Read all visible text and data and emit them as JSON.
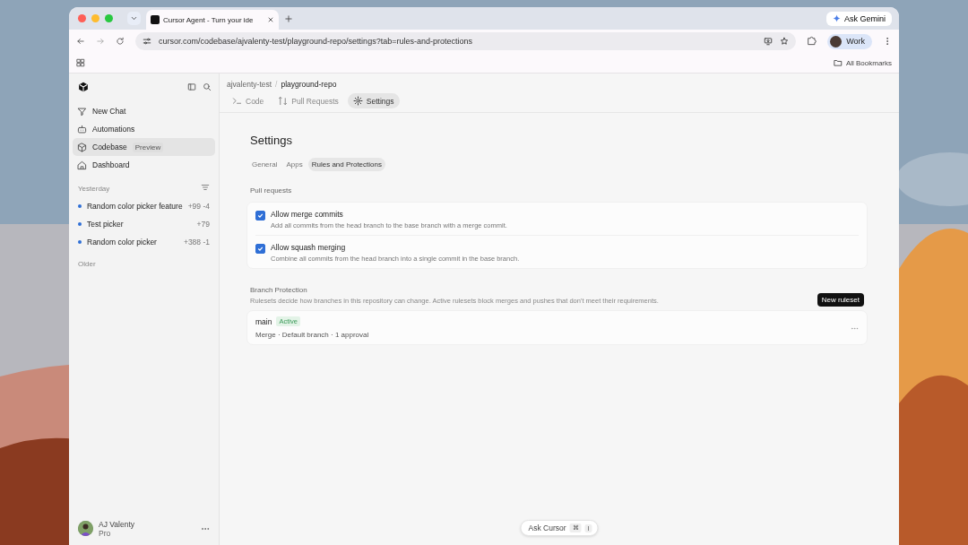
{
  "browser": {
    "tab_title": "Cursor Agent - Turn your ide",
    "url": "cursor.com/codebase/ajvalenty-test/playground-repo/settings?tab=rules-and-protections",
    "ask_gemini": "Ask Gemini",
    "profile": "Work",
    "bookmarks": "All Bookmarks"
  },
  "sidebar": {
    "nav": [
      {
        "label": "New Chat",
        "selected": false
      },
      {
        "label": "Automations",
        "selected": false
      },
      {
        "label": "Codebase",
        "badge": "Preview",
        "selected": true
      },
      {
        "label": "Dashboard",
        "selected": false
      }
    ],
    "groups": [
      {
        "label": "Yesterday",
        "chats": [
          {
            "title": "Random color picker feature",
            "stats": "+99 -4"
          },
          {
            "title": "Test picker",
            "stats": "+79"
          },
          {
            "title": "Random color picker",
            "stats": "+388 -1"
          }
        ]
      },
      {
        "label": "Older"
      }
    ],
    "user": {
      "name": "AJ Valenty",
      "plan": "Pro"
    }
  },
  "main": {
    "breadcrumb": {
      "owner": "ajvalenty-test",
      "separator": "/",
      "repo": "playground-repo"
    },
    "tabs": [
      {
        "label": "Code",
        "selected": false
      },
      {
        "label": "Pull Requests",
        "selected": false
      },
      {
        "label": "Settings",
        "selected": true
      }
    ],
    "title": "Settings",
    "subtabs": [
      {
        "label": "General",
        "selected": false
      },
      {
        "label": "Apps",
        "selected": false
      },
      {
        "label": "Rules and Protections",
        "selected": true
      }
    ],
    "pull_requests": {
      "label": "Pull requests",
      "options": [
        {
          "label": "Allow merge commits",
          "description": "Add all commits from the head branch to the base branch with a merge commit.",
          "checked": true
        },
        {
          "label": "Allow squash merging",
          "description": "Combine all commits from the head branch into a single commit in the base branch.",
          "checked": true
        }
      ]
    },
    "branch_protection": {
      "title": "Branch Protection",
      "description": "Rulesets decide how branches in this repository can change. Active rulesets block merges and pushes that don't meet their requirements.",
      "button": "New ruleset",
      "rulesets": [
        {
          "name": "main",
          "status": "Active",
          "details": "Merge · Default branch · 1 approval"
        }
      ]
    },
    "ask": {
      "label": "Ask Cursor",
      "keys": [
        "⌘",
        "I"
      ]
    }
  }
}
